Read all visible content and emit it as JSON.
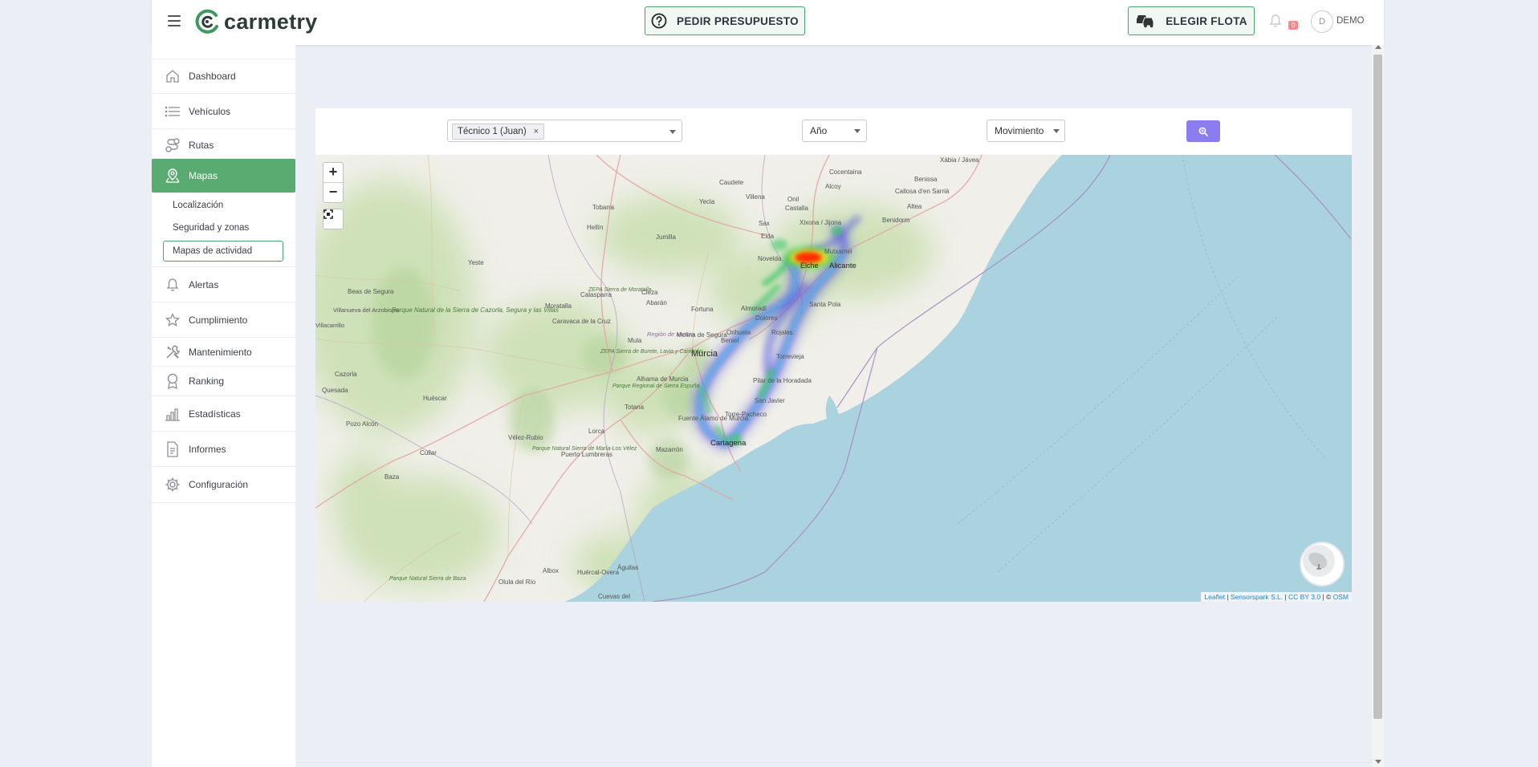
{
  "header": {
    "brand": "carmetry",
    "budget_label": "PEDIR PRESUPUESTO",
    "fleet_label": "ELEGIR FLOTA",
    "notifications_count": "0",
    "avatar_initial": "D",
    "user_name": "DEMO"
  },
  "sidebar": {
    "items": [
      {
        "label": "Dashboard",
        "icon": "home-icon"
      },
      {
        "label": "Vehículos",
        "icon": "list-icon"
      },
      {
        "label": "Rutas",
        "icon": "route-icon"
      },
      {
        "label": "Mapas",
        "icon": "map-pin-icon"
      },
      {
        "label": "Alertas",
        "icon": "bell-icon"
      },
      {
        "label": "Cumplimiento",
        "icon": "star-icon"
      },
      {
        "label": "Mantenimiento",
        "icon": "tools-icon"
      },
      {
        "label": "Ranking",
        "icon": "medal-icon"
      },
      {
        "label": "Estadísticas",
        "icon": "chart-icon"
      },
      {
        "label": "Informes",
        "icon": "document-icon"
      },
      {
        "label": "Configuración",
        "icon": "gear-icon"
      }
    ],
    "sub_items": [
      "Localización",
      "Seguridad y zonas",
      "Mapas de actividad"
    ]
  },
  "filters": {
    "driver_chip": "Técnico 1 (Juan)",
    "chip_remove": "×",
    "period": "Año",
    "map_type": "Movimiento"
  },
  "map": {
    "zoom_in": "+",
    "zoom_out": "−",
    "places": {
      "murcia": "Murcia",
      "alicante": "Alicante",
      "cartagena": "Cartagena",
      "elche": "Elche",
      "orihuela": "Orihuela",
      "torrevieja": "Torrevieja",
      "santa_pola": "Santa Pola",
      "benidorm": "Benidorm",
      "albacete_region": "Hellín",
      "jumilla": "Jumilla",
      "yecla": "Yecla",
      "villena": "Villena",
      "cieza": "Cieza",
      "lorca": "Lorca",
      "mazarron": "Mazarrón",
      "aguilas": "Águilas",
      "totana": "Totana",
      "caravaca": "Caravaca de la Cruz",
      "calasparra": "Calasparra",
      "moratalla": "Moratalla",
      "yeste": "Yeste",
      "huescar": "Huéscar",
      "baza": "Baza",
      "cullar": "Cúllar",
      "velez_rubio": "Vélez-Rubio",
      "cazorla": "Cazorla",
      "quesada": "Quesada",
      "pozo_alcon": "Pozo Alcón",
      "beas": "Beas de Segura",
      "villanueva": "Villanueva del Arzobispo",
      "villacarrillo": "Villacarrillo",
      "tobarra": "Tobarra",
      "caudete": "Caudete",
      "onil": "Onil",
      "castalla": "Castalla",
      "xixona": "Xixona / Jijona",
      "sax": "Sax",
      "elda": "Elda",
      "novelda": "Novelda",
      "cocentaina": "Cocentaina",
      "alcoy": "Alcoy",
      "callosa": "Callosa d'en Sarrià",
      "altea": "Altea",
      "benissa": "Benissa",
      "xabia": "Xàbia / Jávea",
      "mutxamel": "Mutxamel",
      "fortuna": "Fortuna",
      "abanilla": "Abarán",
      "mula": "Mula",
      "molina": "Molina de Segura",
      "beniel": "Beniel",
      "almoradi": "Almoradí",
      "dolores": "Dolores",
      "rojales": "Rojales",
      "pilar": "Pilar de la Horadada",
      "sanjavier": "San Javier",
      "torre_pacheco": "Torre-Pacheco",
      "fuente_alamo": "Fuente Álamo de Murcia",
      "alhama": "Alhama de Murcia",
      "puerto_lumbreras": "Puerto Lumbreras",
      "huercal": "Huércal-Overa",
      "albox": "Albox",
      "olula": "Olula del Río",
      "cuevas": "Cuevas del",
      "parque_cazorla": "Parque Natural de la Sierra de Cazorla, Segura y las Villas",
      "zepa_moratalla": "ZEPA Sierra de Moratalla",
      "zepa_burete": "ZEPA Sierra de Burete, Lavia y Cambrón",
      "parque_espuna": "Parque Regional de Sierra Espuña",
      "parque_velez": "Parque Natural Sierra de María-Los Vélez",
      "parque_baza": "Parque Natural Sierra de Baza",
      "region_murcia": "Región de Murcia"
    },
    "attribution": {
      "leaflet": "Leaflet",
      "sensorspark": "Sensorspark S.L.",
      "license": "CC BY 3.0",
      "osm": "OSM",
      "sep1": " | ",
      "copyright": " | © "
    }
  },
  "colors": {
    "accent_green": "#5aab72",
    "search_button": "#8b7cf0",
    "sea": "#aad3df",
    "heat_hot": "#ff2200"
  }
}
